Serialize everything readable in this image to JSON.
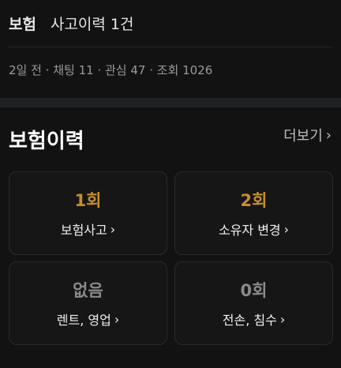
{
  "summary": {
    "label": "보험",
    "value": "사고이력 1건"
  },
  "meta": "2일 전 · 채팅 11 · 관심 47 · 조회 1026",
  "section": {
    "title": "보험이력",
    "more_label": "더보기",
    "chevron": "›"
  },
  "cards": [
    {
      "value": "1회",
      "label": "보험사고",
      "value_color": "#c88e2a"
    },
    {
      "value": "2회",
      "label": "소유자 변경",
      "value_color": "#c88e2a"
    },
    {
      "value": "없음",
      "label": "렌트, 영업",
      "value_color": "#8a8a8a"
    },
    {
      "value": "0회",
      "label": "전손, 침수",
      "value_color": "#8a8a8a"
    }
  ]
}
